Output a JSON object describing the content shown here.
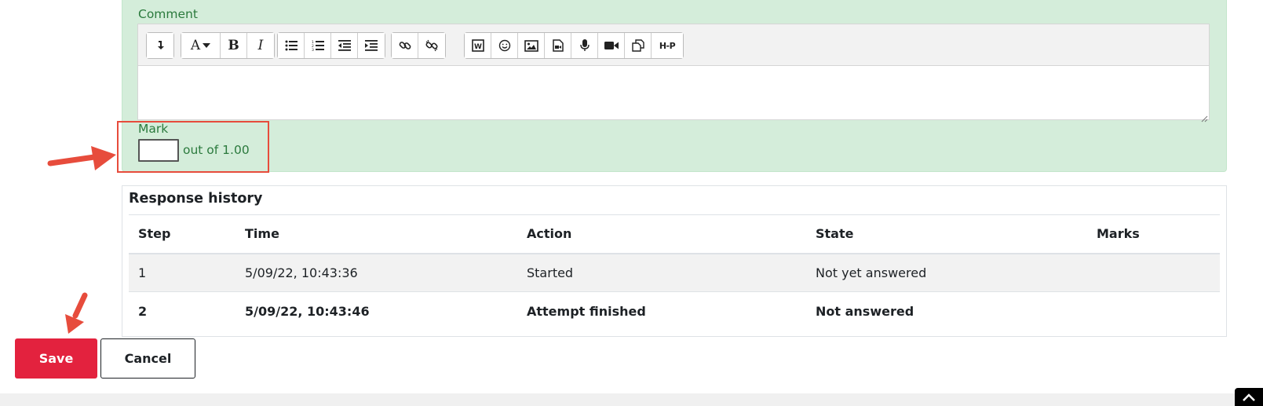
{
  "comment": {
    "label": "Comment",
    "toolbar": {
      "groups": [
        [
          "collapse-icon"
        ],
        [
          "font-style-icon",
          "bold-icon",
          "italic-icon"
        ],
        [
          "unordered-list-icon",
          "ordered-list-icon",
          "outdent-icon",
          "indent-icon"
        ],
        [
          "link-icon",
          "unlink-icon"
        ],
        [
          "word-import-icon",
          "emoji-icon",
          "image-icon",
          "media-icon",
          "record-audio-icon",
          "record-video-icon",
          "manage-files-icon",
          "h5p-icon"
        ]
      ],
      "bold_glyph": "B",
      "italic_glyph": "I",
      "font_glyph": "A",
      "h5p_glyph": "H-P"
    },
    "editor_value": ""
  },
  "mark": {
    "label": "Mark",
    "value": "",
    "out_of": "out of 1.00"
  },
  "history": {
    "title": "Response history",
    "columns": [
      "Step",
      "Time",
      "Action",
      "State",
      "Marks"
    ],
    "rows": [
      {
        "step": "1",
        "time": "5/09/22, 10:43:36",
        "action": "Started",
        "state": "Not yet answered",
        "marks": ""
      },
      {
        "step": "2",
        "time": "5/09/22, 10:43:46",
        "action": "Attempt finished",
        "state": "Not answered",
        "marks": ""
      }
    ]
  },
  "buttons": {
    "save": "Save",
    "cancel": "Cancel"
  },
  "colors": {
    "panel_green": "#d4edda",
    "label_green": "#2b7a3d",
    "save_red": "#e3223e",
    "annotation_red": "#e74c3c"
  }
}
